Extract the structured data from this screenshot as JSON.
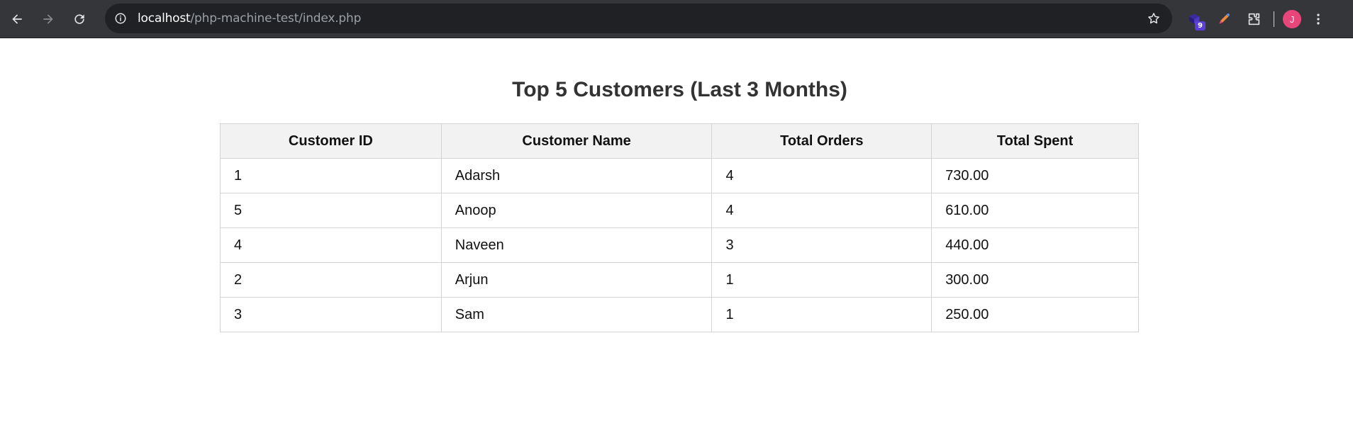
{
  "browser": {
    "url_host": "localhost",
    "url_path": "/php-machine-test/index.php",
    "extension_badge": "9",
    "profile_initial": "J",
    "icons": [
      "back-icon",
      "forward-icon",
      "reload-icon",
      "site-info-icon",
      "bookmark-star-icon",
      "extension-icon",
      "pen-icon",
      "puzzle-icon",
      "kebab-menu-icon"
    ],
    "colors": {
      "toolbar": "#35363a",
      "omnibox": "#202124",
      "avatar": "#e8457a",
      "badge": "#5b3fd6"
    }
  },
  "page": {
    "title": "Top 5 Customers (Last 3 Months)",
    "table": {
      "headers": [
        "Customer ID",
        "Customer Name",
        "Total Orders",
        "Total Spent"
      ],
      "rows": [
        [
          "1",
          "Adarsh",
          "4",
          "730.00"
        ],
        [
          "5",
          "Anoop",
          "4",
          "610.00"
        ],
        [
          "4",
          "Naveen",
          "3",
          "440.00"
        ],
        [
          "2",
          "Arjun",
          "1",
          "300.00"
        ],
        [
          "3",
          "Sam",
          "1",
          "250.00"
        ]
      ]
    }
  }
}
